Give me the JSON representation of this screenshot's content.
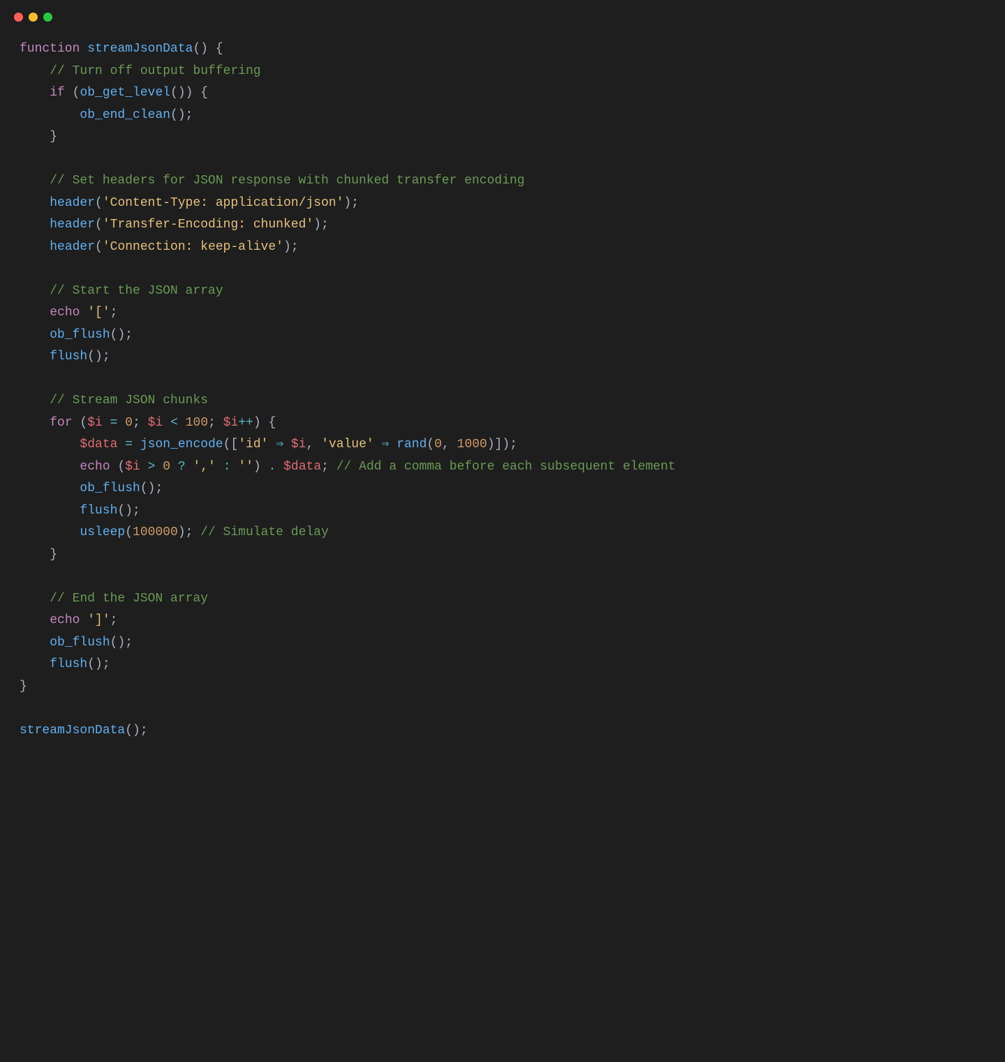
{
  "code": {
    "lines": [
      [
        {
          "cls": "tok-keyword",
          "t": "function"
        },
        {
          "cls": "tok-default",
          "t": " "
        },
        {
          "cls": "tok-function",
          "t": "streamJsonData"
        },
        {
          "cls": "tok-paren",
          "t": "() {"
        }
      ],
      [
        {
          "cls": "tok-default",
          "t": "    "
        },
        {
          "cls": "tok-comment",
          "t": "// Turn off output buffering"
        }
      ],
      [
        {
          "cls": "tok-default",
          "t": "    "
        },
        {
          "cls": "tok-keyword",
          "t": "if"
        },
        {
          "cls": "tok-paren",
          "t": " ("
        },
        {
          "cls": "tok-function",
          "t": "ob_get_level"
        },
        {
          "cls": "tok-paren",
          "t": "()) {"
        }
      ],
      [
        {
          "cls": "tok-default",
          "t": "        "
        },
        {
          "cls": "tok-function",
          "t": "ob_end_clean"
        },
        {
          "cls": "tok-paren",
          "t": "();"
        }
      ],
      [
        {
          "cls": "tok-default",
          "t": "    "
        },
        {
          "cls": "tok-paren",
          "t": "}"
        }
      ],
      [
        {
          "cls": "tok-default",
          "t": ""
        }
      ],
      [
        {
          "cls": "tok-default",
          "t": "    "
        },
        {
          "cls": "tok-comment",
          "t": "// Set headers for JSON response with chunked transfer encoding"
        }
      ],
      [
        {
          "cls": "tok-default",
          "t": "    "
        },
        {
          "cls": "tok-function",
          "t": "header"
        },
        {
          "cls": "tok-paren",
          "t": "("
        },
        {
          "cls": "tok-string",
          "t": "'Content-Type: application/json'"
        },
        {
          "cls": "tok-paren",
          "t": ");"
        }
      ],
      [
        {
          "cls": "tok-default",
          "t": "    "
        },
        {
          "cls": "tok-function",
          "t": "header"
        },
        {
          "cls": "tok-paren",
          "t": "("
        },
        {
          "cls": "tok-string",
          "t": "'Transfer-Encoding: chunked'"
        },
        {
          "cls": "tok-paren",
          "t": ");"
        }
      ],
      [
        {
          "cls": "tok-default",
          "t": "    "
        },
        {
          "cls": "tok-function",
          "t": "header"
        },
        {
          "cls": "tok-paren",
          "t": "("
        },
        {
          "cls": "tok-string",
          "t": "'Connection: keep-alive'"
        },
        {
          "cls": "tok-paren",
          "t": ");"
        }
      ],
      [
        {
          "cls": "tok-default",
          "t": ""
        }
      ],
      [
        {
          "cls": "tok-default",
          "t": "    "
        },
        {
          "cls": "tok-comment",
          "t": "// Start the JSON array"
        }
      ],
      [
        {
          "cls": "tok-default",
          "t": "    "
        },
        {
          "cls": "tok-echo",
          "t": "echo"
        },
        {
          "cls": "tok-default",
          "t": " "
        },
        {
          "cls": "tok-string",
          "t": "'['"
        },
        {
          "cls": "tok-paren",
          "t": ";"
        }
      ],
      [
        {
          "cls": "tok-default",
          "t": "    "
        },
        {
          "cls": "tok-function",
          "t": "ob_flush"
        },
        {
          "cls": "tok-paren",
          "t": "();"
        }
      ],
      [
        {
          "cls": "tok-default",
          "t": "    "
        },
        {
          "cls": "tok-function",
          "t": "flush"
        },
        {
          "cls": "tok-paren",
          "t": "();"
        }
      ],
      [
        {
          "cls": "tok-default",
          "t": ""
        }
      ],
      [
        {
          "cls": "tok-default",
          "t": "    "
        },
        {
          "cls": "tok-comment",
          "t": "// Stream JSON chunks"
        }
      ],
      [
        {
          "cls": "tok-default",
          "t": "    "
        },
        {
          "cls": "tok-keyword",
          "t": "for"
        },
        {
          "cls": "tok-paren",
          "t": " ("
        },
        {
          "cls": "tok-variable",
          "t": "$i"
        },
        {
          "cls": "tok-default",
          "t": " "
        },
        {
          "cls": "tok-operator",
          "t": "="
        },
        {
          "cls": "tok-default",
          "t": " "
        },
        {
          "cls": "tok-number",
          "t": "0"
        },
        {
          "cls": "tok-paren",
          "t": "; "
        },
        {
          "cls": "tok-variable",
          "t": "$i"
        },
        {
          "cls": "tok-default",
          "t": " "
        },
        {
          "cls": "tok-operator",
          "t": "<"
        },
        {
          "cls": "tok-default",
          "t": " "
        },
        {
          "cls": "tok-number",
          "t": "100"
        },
        {
          "cls": "tok-paren",
          "t": "; "
        },
        {
          "cls": "tok-variable",
          "t": "$i"
        },
        {
          "cls": "tok-operator",
          "t": "++"
        },
        {
          "cls": "tok-paren",
          "t": ") {"
        }
      ],
      [
        {
          "cls": "tok-default",
          "t": "        "
        },
        {
          "cls": "tok-variable",
          "t": "$data"
        },
        {
          "cls": "tok-default",
          "t": " "
        },
        {
          "cls": "tok-operator",
          "t": "="
        },
        {
          "cls": "tok-default",
          "t": " "
        },
        {
          "cls": "tok-function",
          "t": "json_encode"
        },
        {
          "cls": "tok-paren",
          "t": "(["
        },
        {
          "cls": "tok-string",
          "t": "'id'"
        },
        {
          "cls": "tok-default",
          "t": " "
        },
        {
          "cls": "tok-arrow",
          "t": "⇒"
        },
        {
          "cls": "tok-default",
          "t": " "
        },
        {
          "cls": "tok-variable",
          "t": "$i"
        },
        {
          "cls": "tok-paren",
          "t": ", "
        },
        {
          "cls": "tok-string",
          "t": "'value'"
        },
        {
          "cls": "tok-default",
          "t": " "
        },
        {
          "cls": "tok-arrow",
          "t": "⇒"
        },
        {
          "cls": "tok-default",
          "t": " "
        },
        {
          "cls": "tok-function",
          "t": "rand"
        },
        {
          "cls": "tok-paren",
          "t": "("
        },
        {
          "cls": "tok-number",
          "t": "0"
        },
        {
          "cls": "tok-paren",
          "t": ", "
        },
        {
          "cls": "tok-number",
          "t": "1000"
        },
        {
          "cls": "tok-paren",
          "t": ")]);"
        }
      ],
      [
        {
          "cls": "tok-default",
          "t": "        "
        },
        {
          "cls": "tok-echo",
          "t": "echo"
        },
        {
          "cls": "tok-default",
          "t": " ("
        },
        {
          "cls": "tok-variable",
          "t": "$i"
        },
        {
          "cls": "tok-default",
          "t": " "
        },
        {
          "cls": "tok-operator",
          "t": ">"
        },
        {
          "cls": "tok-default",
          "t": " "
        },
        {
          "cls": "tok-number",
          "t": "0"
        },
        {
          "cls": "tok-default",
          "t": " "
        },
        {
          "cls": "tok-operator",
          "t": "?"
        },
        {
          "cls": "tok-default",
          "t": " "
        },
        {
          "cls": "tok-string",
          "t": "','"
        },
        {
          "cls": "tok-default",
          "t": " "
        },
        {
          "cls": "tok-operator",
          "t": ":"
        },
        {
          "cls": "tok-default",
          "t": " "
        },
        {
          "cls": "tok-string",
          "t": "''"
        },
        {
          "cls": "tok-paren",
          "t": ") "
        },
        {
          "cls": "tok-operator",
          "t": "."
        },
        {
          "cls": "tok-default",
          "t": " "
        },
        {
          "cls": "tok-variable",
          "t": "$data"
        },
        {
          "cls": "tok-paren",
          "t": "; "
        },
        {
          "cls": "tok-comment",
          "t": "// Add a comma before each subsequent element"
        }
      ],
      [
        {
          "cls": "tok-default",
          "t": "        "
        },
        {
          "cls": "tok-function",
          "t": "ob_flush"
        },
        {
          "cls": "tok-paren",
          "t": "();"
        }
      ],
      [
        {
          "cls": "tok-default",
          "t": "        "
        },
        {
          "cls": "tok-function",
          "t": "flush"
        },
        {
          "cls": "tok-paren",
          "t": "();"
        }
      ],
      [
        {
          "cls": "tok-default",
          "t": "        "
        },
        {
          "cls": "tok-function",
          "t": "usleep"
        },
        {
          "cls": "tok-paren",
          "t": "("
        },
        {
          "cls": "tok-number",
          "t": "100000"
        },
        {
          "cls": "tok-paren",
          "t": "); "
        },
        {
          "cls": "tok-comment",
          "t": "// Simulate delay"
        }
      ],
      [
        {
          "cls": "tok-default",
          "t": "    "
        },
        {
          "cls": "tok-paren",
          "t": "}"
        }
      ],
      [
        {
          "cls": "tok-default",
          "t": ""
        }
      ],
      [
        {
          "cls": "tok-default",
          "t": "    "
        },
        {
          "cls": "tok-comment",
          "t": "// End the JSON array"
        }
      ],
      [
        {
          "cls": "tok-default",
          "t": "    "
        },
        {
          "cls": "tok-echo",
          "t": "echo"
        },
        {
          "cls": "tok-default",
          "t": " "
        },
        {
          "cls": "tok-string",
          "t": "']'"
        },
        {
          "cls": "tok-paren",
          "t": ";"
        }
      ],
      [
        {
          "cls": "tok-default",
          "t": "    "
        },
        {
          "cls": "tok-function",
          "t": "ob_flush"
        },
        {
          "cls": "tok-paren",
          "t": "();"
        }
      ],
      [
        {
          "cls": "tok-default",
          "t": "    "
        },
        {
          "cls": "tok-function",
          "t": "flush"
        },
        {
          "cls": "tok-paren",
          "t": "();"
        }
      ],
      [
        {
          "cls": "tok-paren",
          "t": "}"
        }
      ],
      [
        {
          "cls": "tok-default",
          "t": ""
        }
      ],
      [
        {
          "cls": "tok-function",
          "t": "streamJsonData"
        },
        {
          "cls": "tok-paren",
          "t": "();"
        }
      ]
    ]
  }
}
